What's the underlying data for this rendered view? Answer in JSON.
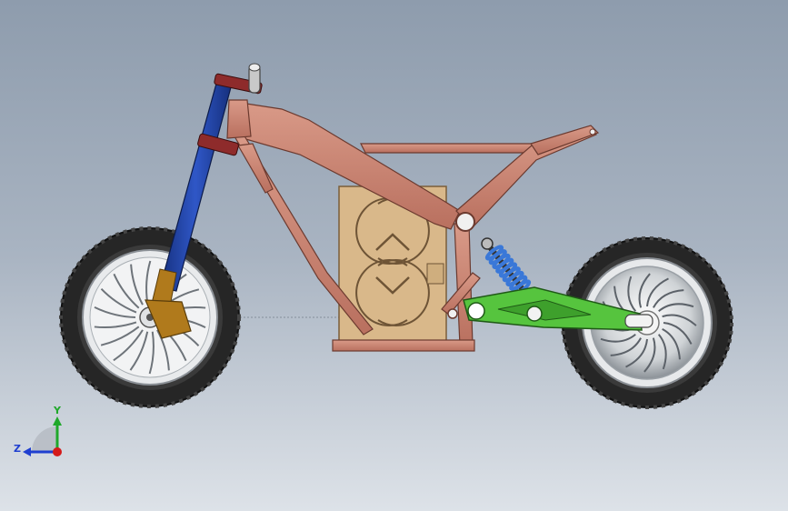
{
  "viewport": {
    "background_top": "#8e9cad",
    "background_bottom": "#dde2e8"
  },
  "model": {
    "frame_color": "#c9806e",
    "fork_color": "#1f3fa3",
    "fork_slider_color": "#b07a1c",
    "battery_color": "#d9b88a",
    "swingarm_color": "#4fbf3a",
    "shock_spring_color": "#3a78d8",
    "clamp_color": "#8e2b2b",
    "tire_color": "#2b2b2b",
    "rim_color": "#d8dadc"
  },
  "triad": {
    "y_label": "Y",
    "z_label": "Z",
    "y_color": "#1fa82a",
    "z_color": "#1f3fd0",
    "x_color": "#d41a1a"
  }
}
